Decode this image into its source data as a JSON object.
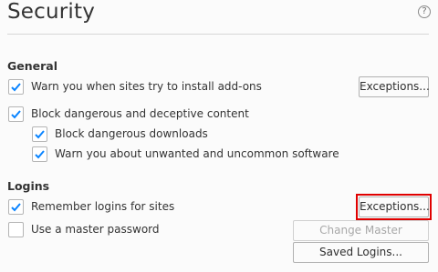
{
  "title": "Security",
  "help_icon": "?",
  "general": {
    "heading": "General",
    "warn_addons": {
      "label": "Warn you when sites try to install add-ons",
      "checked": true
    },
    "exceptions_label": "Exceptions...",
    "block_dangerous": {
      "label": "Block dangerous and deceptive content",
      "checked": true
    },
    "block_downloads": {
      "label": "Block dangerous downloads",
      "checked": true
    },
    "warn_unwanted": {
      "label": "Warn you about unwanted and uncommon software",
      "checked": true
    }
  },
  "logins": {
    "heading": "Logins",
    "remember_logins": {
      "label": "Remember logins for sites",
      "checked": true
    },
    "exceptions_label": "Exceptions...",
    "master_password": {
      "label": "Use a master password",
      "checked": false
    },
    "change_master_label": "Change Master Password...",
    "saved_logins_label": "Saved Logins..."
  },
  "colors": {
    "check": "#0a84ff",
    "highlight": "#e00000"
  }
}
